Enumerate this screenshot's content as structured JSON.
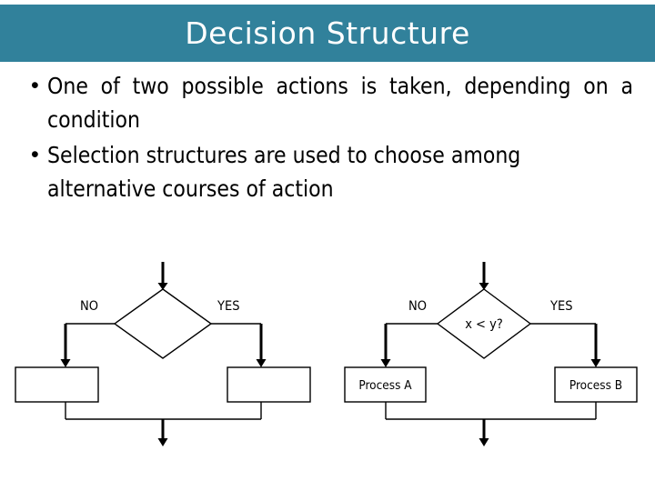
{
  "slide": {
    "title": "Decision Structure",
    "title_band_color": "#31819b",
    "title_text_color": "#ffffff",
    "background_color": "#ffffff"
  },
  "body": {
    "bullet_glyph": "•",
    "bullets": [
      "One of two possible actions is taken, depending on a condition",
      "Selection structures are used to choose among alternative courses of action"
    ]
  },
  "diagrams": [
    {
      "name": "generic-decision-flowchart",
      "condition_label": "",
      "false_branch_label": "NO",
      "true_branch_label": "YES",
      "false_process_label": "",
      "true_process_label": ""
    },
    {
      "name": "example-decision-flowchart",
      "condition_label": "x < y?",
      "false_branch_label": "NO",
      "true_branch_label": "YES",
      "false_process_label": "Process A",
      "true_process_label": "Process B"
    }
  ]
}
